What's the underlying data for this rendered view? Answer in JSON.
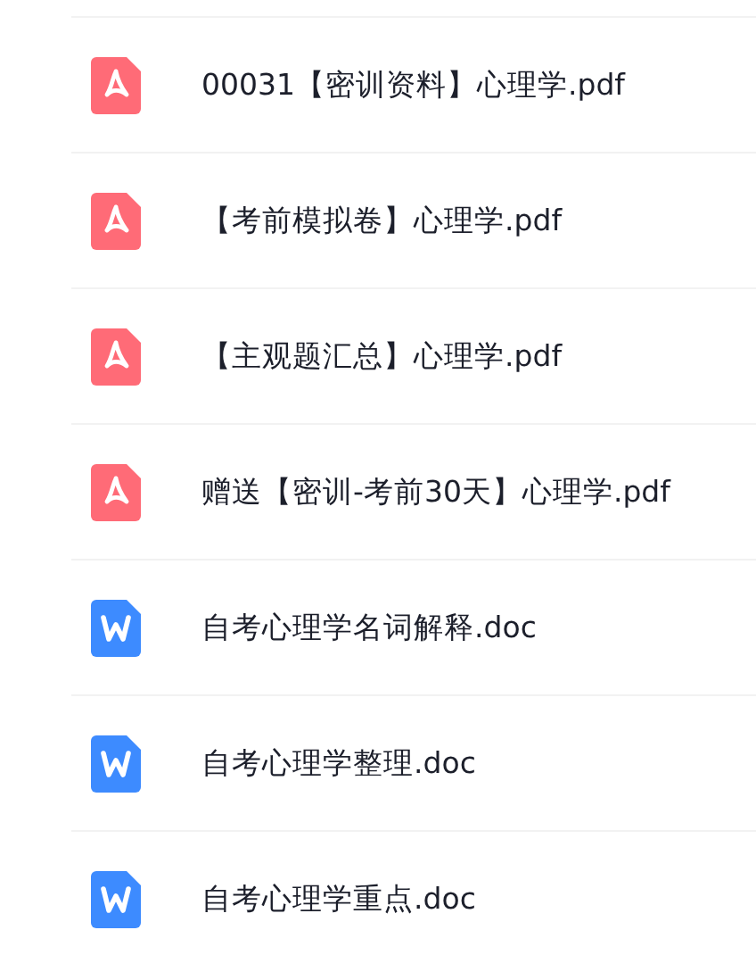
{
  "files": [
    {
      "name": "00031【密训资料】心理学.pdf",
      "kind": "pdf"
    },
    {
      "name": "【考前模拟卷】心理学.pdf",
      "kind": "pdf"
    },
    {
      "name": "【主观题汇总】心理学.pdf",
      "kind": "pdf"
    },
    {
      "name": "赠送【密训-考前30天】心理学.pdf",
      "kind": "pdf"
    },
    {
      "name": "自考心理学名词解释.doc",
      "kind": "doc"
    },
    {
      "name": "自考心理学整理.doc",
      "kind": "doc"
    },
    {
      "name": "自考心理学重点.doc",
      "kind": "doc"
    }
  ]
}
